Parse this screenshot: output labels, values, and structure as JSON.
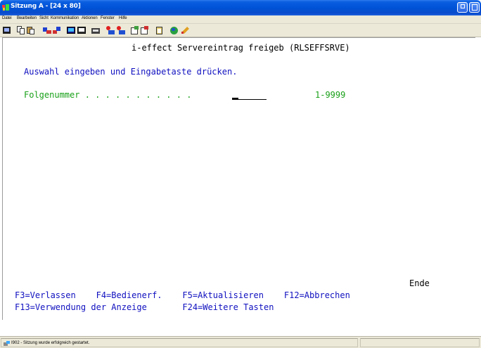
{
  "window": {
    "title": "Sitzung A - [24 x 80]"
  },
  "menu": {
    "items": [
      "Datei",
      "Bearbeiten",
      "Sicht",
      "Kommunikation",
      "Aktionen",
      "Fenster",
      "Hilfe"
    ]
  },
  "toolbar": {
    "icons": [
      "print-screen-icon",
      "copy-icon",
      "paste-icon",
      "send-icon",
      "receive-icon",
      "display-icon",
      "keyboard-icon",
      "macro-icon",
      "record-macro-icon",
      "stop-macro-icon",
      "play-macro-icon",
      "play-macro-alt-icon",
      "clipboard-icon",
      "help-globe-icon",
      "edit-icon"
    ]
  },
  "screen": {
    "header": "i-effect Servereintrag freigeb (RLSEFFSRVE)",
    "instruction": "Auswahl eingeben und Eingabetaste drücken.",
    "field_label": "Folgenummer . . . . . . . . . . .",
    "field_value": "",
    "field_range": "1-9999",
    "end_marker": "Ende",
    "fkeys_row1": "F3=Verlassen    F4=Bedienerf.    F5=Aktualisieren    F12=Abbrechen",
    "fkeys_row2": "F13=Verwendung der Anzeige       F24=Weitere Tasten"
  },
  "status": {
    "message": "I902 - Sitzung wurde erfolgreich gestartet."
  },
  "colors": {
    "title_bar": "#0a5ee0",
    "terminal_blue": "#1010c0",
    "terminal_green": "#18a018",
    "chrome": "#ece9d8"
  }
}
